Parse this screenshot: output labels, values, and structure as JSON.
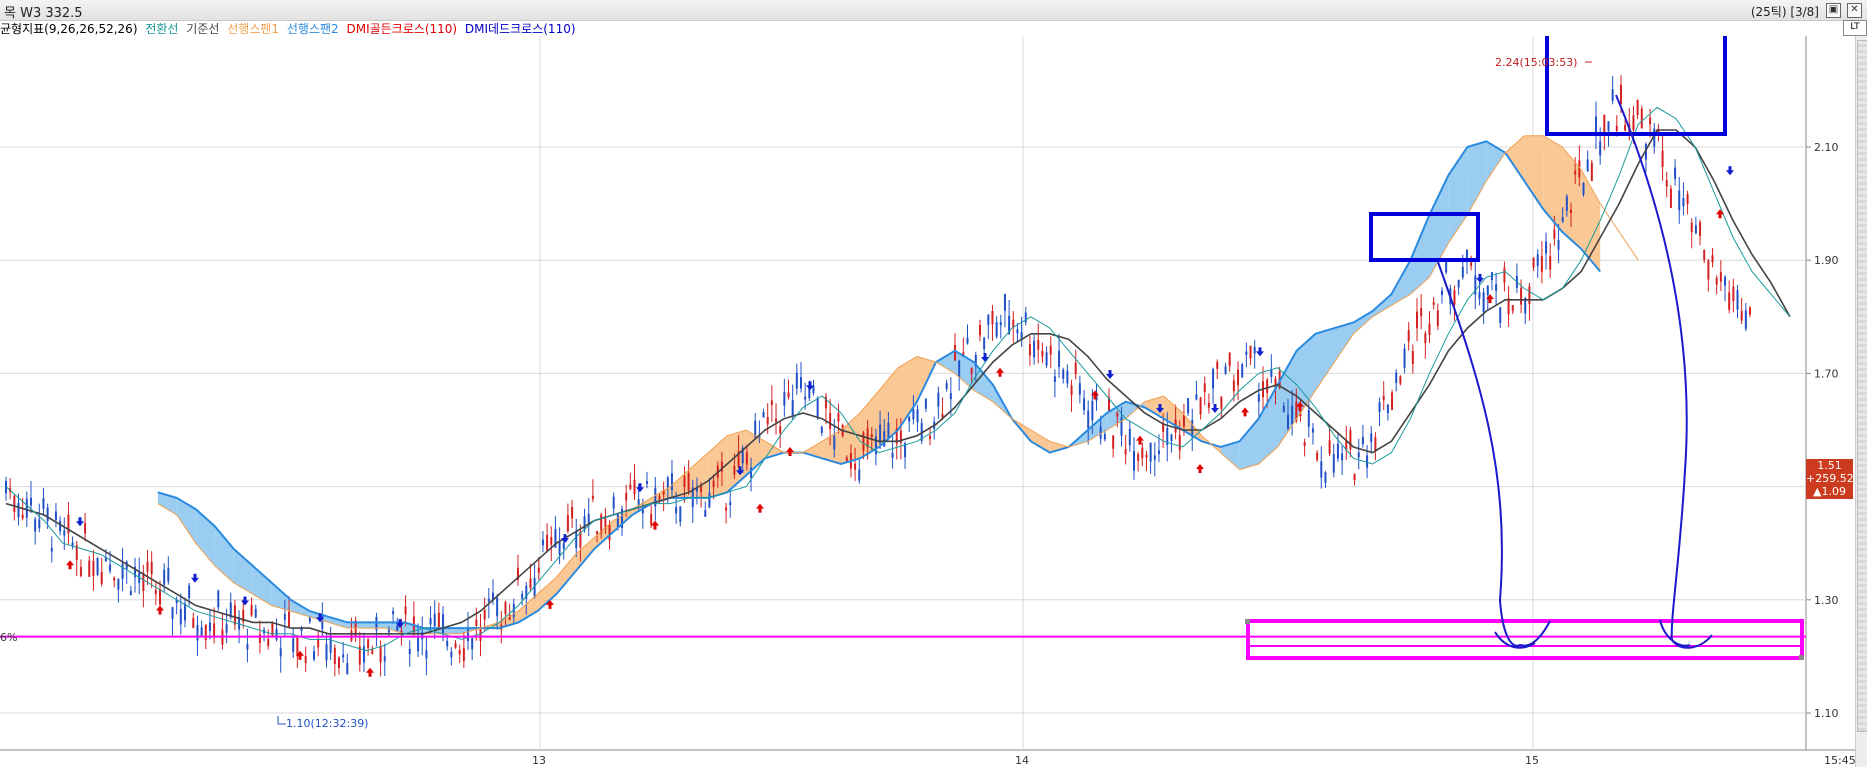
{
  "header": {
    "title": "목 W3 332.5",
    "right_info": "(25틱) [3/8]"
  },
  "legend": {
    "items": [
      {
        "label": "균형지표(9,26,26,52,26)",
        "color": "#000000"
      },
      {
        "label": "전환선",
        "color": "#1a9a9a"
      },
      {
        "label": "기준선",
        "color": "#444444"
      },
      {
        "label": "선행스팬1",
        "color": "#f0a050"
      },
      {
        "label": "선행스팬2",
        "color": "#2a8ae0"
      },
      {
        "label": "DMI골든크로스(110)",
        "color": "#e00000"
      },
      {
        "label": "DMI데드크로스(110)",
        "color": "#0000cc"
      }
    ]
  },
  "price_box": {
    "price": "1.51",
    "change_pct": "+259.52%",
    "change": "▲1.09"
  },
  "scroll_button": "LT",
  "colors": {
    "tenkan": "#1a9a9a",
    "kijun": "#444444",
    "span1_cloud": "#f9c28a",
    "span2_cloud": "#8fc8f0",
    "span2_line": "#2a8ae0",
    "candle_up": "#d42020",
    "candle_down": "#2050c8",
    "horizontal_line": "#ff00ff",
    "annotation_box": "#0000dd",
    "support_box": "#ff00ff"
  },
  "chart_data": {
    "type": "line",
    "y_axis_ticks": [
      "1.10",
      "1.30",
      "1.50",
      "1.70",
      "1.90",
      "2.10"
    ],
    "ylim": [
      1.03,
      2.28
    ],
    "x_axis_ticks": [
      "13",
      "14",
      "15",
      "15:45"
    ],
    "annotations": {
      "high_label": "2.24(15:03:53)",
      "low_label": "1.10(12:32:39)",
      "left_label": "6%"
    },
    "horizontal_line_value": 1.235,
    "series": [
      {
        "name": "전환선",
        "values": [
          1.5,
          1.47,
          1.44,
          1.4,
          1.39,
          1.38,
          1.36,
          1.34,
          1.32,
          1.3,
          1.28,
          1.27,
          1.26,
          1.25,
          1.24,
          1.24,
          1.23,
          1.23,
          1.22,
          1.21,
          1.22,
          1.24,
          1.25,
          1.24,
          1.23,
          1.24,
          1.26,
          1.29,
          1.33,
          1.37,
          1.41,
          1.44,
          1.45,
          1.46,
          1.47,
          1.47,
          1.48,
          1.48,
          1.49,
          1.5,
          1.55,
          1.6,
          1.64,
          1.66,
          1.63,
          1.58,
          1.56,
          1.57,
          1.58,
          1.6,
          1.63,
          1.69,
          1.74,
          1.78,
          1.8,
          1.78,
          1.74,
          1.7,
          1.66,
          1.62,
          1.6,
          1.58,
          1.57,
          1.6,
          1.63,
          1.67,
          1.7,
          1.71,
          1.68,
          1.64,
          1.59,
          1.55,
          1.54,
          1.56,
          1.62,
          1.7,
          1.77,
          1.83,
          1.87,
          1.88,
          1.85,
          1.83,
          1.85,
          1.9,
          1.97,
          2.05,
          2.14,
          2.17,
          2.15,
          2.1,
          2.02,
          1.94,
          1.88,
          1.84,
          1.8
        ]
      },
      {
        "name": "기준선",
        "values": [
          1.47,
          1.46,
          1.45,
          1.43,
          1.41,
          1.39,
          1.37,
          1.35,
          1.33,
          1.31,
          1.29,
          1.28,
          1.27,
          1.26,
          1.26,
          1.25,
          1.25,
          1.24,
          1.24,
          1.24,
          1.24,
          1.24,
          1.24,
          1.25,
          1.26,
          1.28,
          1.31,
          1.34,
          1.37,
          1.4,
          1.42,
          1.44,
          1.45,
          1.46,
          1.47,
          1.48,
          1.49,
          1.51,
          1.54,
          1.57,
          1.6,
          1.62,
          1.63,
          1.62,
          1.6,
          1.59,
          1.58,
          1.58,
          1.59,
          1.61,
          1.64,
          1.68,
          1.72,
          1.75,
          1.77,
          1.77,
          1.76,
          1.73,
          1.69,
          1.66,
          1.63,
          1.61,
          1.6,
          1.6,
          1.62,
          1.65,
          1.67,
          1.68,
          1.66,
          1.63,
          1.6,
          1.57,
          1.56,
          1.58,
          1.63,
          1.68,
          1.74,
          1.78,
          1.81,
          1.83,
          1.83,
          1.83,
          1.85,
          1.88,
          1.94,
          2.0,
          2.07,
          2.13,
          2.13,
          2.1,
          2.04,
          1.97,
          1.91,
          1.86,
          1.8
        ]
      },
      {
        "name": "선행스팬1",
        "values": [
          null,
          null,
          null,
          null,
          null,
          null,
          null,
          null,
          1.47,
          1.45,
          1.4,
          1.36,
          1.33,
          1.31,
          1.29,
          1.28,
          1.27,
          1.26,
          1.25,
          1.25,
          1.25,
          1.24,
          1.24,
          1.24,
          1.24,
          1.25,
          1.26,
          1.28,
          1.31,
          1.34,
          1.38,
          1.41,
          1.44,
          1.46,
          1.48,
          1.5,
          1.53,
          1.56,
          1.59,
          1.6,
          1.58,
          1.56,
          1.56,
          1.58,
          1.6,
          1.63,
          1.67,
          1.71,
          1.73,
          1.72,
          1.7,
          1.67,
          1.65,
          1.62,
          1.6,
          1.58,
          1.57,
          1.58,
          1.6,
          1.62,
          1.65,
          1.66,
          1.63,
          1.59,
          1.56,
          1.53,
          1.54,
          1.57,
          1.62,
          1.67,
          1.72,
          1.77,
          1.8,
          1.82,
          1.84,
          1.87,
          1.93,
          1.98,
          2.04,
          2.09,
          2.12,
          2.12,
          2.1,
          2.06,
          2.0,
          1.95,
          1.9
        ]
      },
      {
        "name": "선행스팬2",
        "values": [
          null,
          null,
          null,
          null,
          null,
          null,
          null,
          null,
          1.49,
          1.48,
          1.46,
          1.43,
          1.39,
          1.36,
          1.33,
          1.3,
          1.28,
          1.27,
          1.26,
          1.26,
          1.26,
          1.26,
          1.25,
          1.25,
          1.25,
          1.25,
          1.25,
          1.26,
          1.28,
          1.31,
          1.35,
          1.39,
          1.42,
          1.45,
          1.47,
          1.48,
          1.48,
          1.48,
          1.49,
          1.52,
          1.55,
          1.56,
          1.56,
          1.55,
          1.54,
          1.55,
          1.57,
          1.6,
          1.65,
          1.72,
          1.74,
          1.72,
          1.68,
          1.62,
          1.58,
          1.56,
          1.57,
          1.6,
          1.63,
          1.65,
          1.64,
          1.62,
          1.6,
          1.58,
          1.57,
          1.58,
          1.62,
          1.68,
          1.74,
          1.77,
          1.78,
          1.79,
          1.81,
          1.84,
          1.9,
          1.98,
          2.05,
          2.1,
          2.11,
          2.09,
          2.04,
          1.99,
          1.95,
          1.92,
          1.88
        ]
      }
    ]
  }
}
